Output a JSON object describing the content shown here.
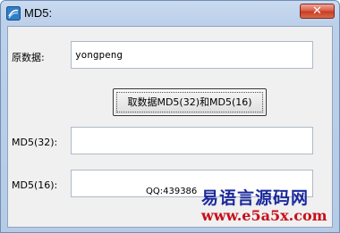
{
  "window": {
    "title": "MD5:",
    "close_label": "✕"
  },
  "form": {
    "source_label": "原数据:",
    "source_value": "yongpeng",
    "button_label": "取数据MD5(32)和MD5(16)",
    "md5_32_label": "MD5(32):",
    "md5_32_value": "",
    "md5_16_label": "MD5(16):",
    "md5_16_value": ""
  },
  "footer": {
    "qq": "QQ:439386"
  },
  "watermark": {
    "title": "易语言源码网",
    "url": "www.e5a5x.com"
  },
  "colors": {
    "watermark_title": "#1b2a9c",
    "watermark_url": "#c8101a",
    "close_button": "#c73a1f"
  },
  "icons": {
    "app": "app-logo-icon",
    "close": "close-icon"
  }
}
